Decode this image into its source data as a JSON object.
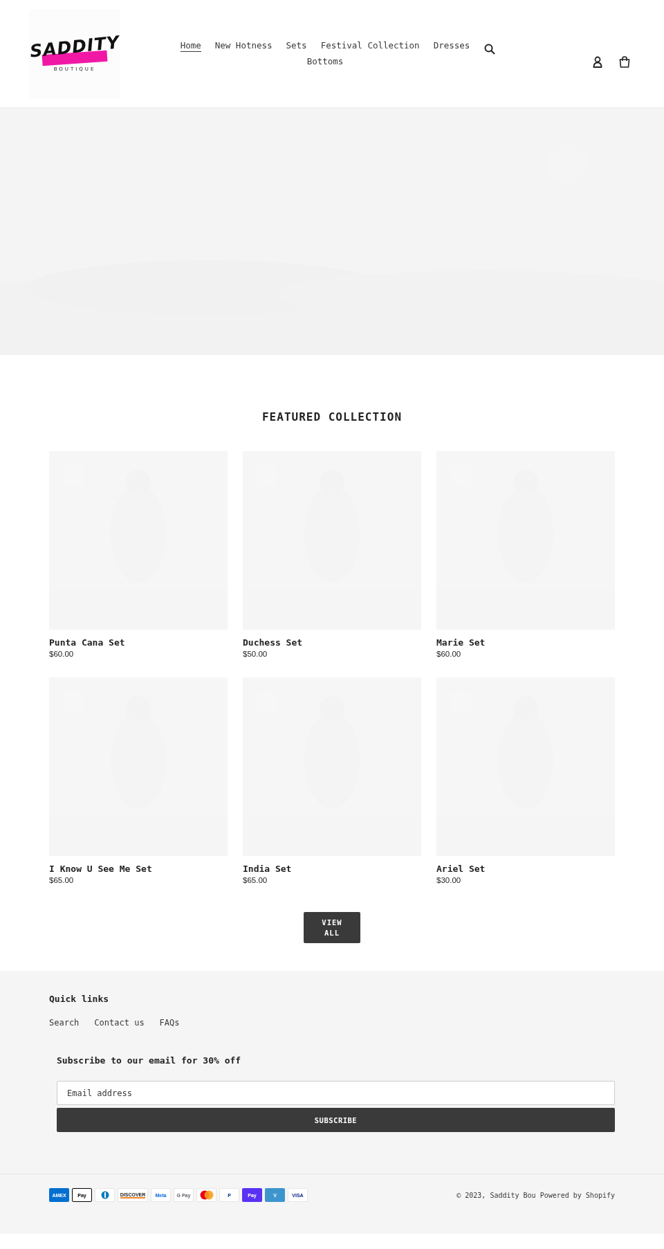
{
  "header": {
    "logo": {
      "title": "SADDITY",
      "subtitle": "BOUTIQUE"
    },
    "nav": [
      {
        "label": "Home",
        "selected": true
      },
      {
        "label": "New Hotness",
        "selected": false
      },
      {
        "label": "Sets",
        "selected": false
      },
      {
        "label": "Festival Collection",
        "selected": false
      },
      {
        "label": "Dresses",
        "selected": false
      },
      {
        "label": "Bottoms",
        "selected": false
      }
    ]
  },
  "featured": {
    "title": "FEATURED COLLECTION",
    "products": [
      {
        "name": "Punta Cana Set",
        "price": "$60.00"
      },
      {
        "name": "Duchess Set",
        "price": "$50.00"
      },
      {
        "name": "Marie Set",
        "price": "$60.00"
      },
      {
        "name": "I Know U See Me Set",
        "price": "$65.00"
      },
      {
        "name": "India Set",
        "price": "$65.00"
      },
      {
        "name": "Ariel Set",
        "price": "$30.00"
      }
    ],
    "button": "VIEW ALL"
  },
  "footer": {
    "quick_links": {
      "title": "Quick links",
      "links": [
        "Search",
        "Contact us",
        "FAQs"
      ]
    },
    "newsletter": {
      "title": "Subscribe to our email for 30% off",
      "placeholder": "Email address",
      "button": "SUBSCRIBE"
    },
    "payments": [
      {
        "kind": "amex",
        "label": "AMEX"
      },
      {
        "kind": "apple",
        "label": "Pay"
      },
      {
        "kind": "diners"
      },
      {
        "kind": "discover",
        "label": "DISCOVER"
      },
      {
        "kind": "meta",
        "label": "Meta"
      },
      {
        "kind": "gpay",
        "label": "G Pay"
      },
      {
        "kind": "mastercard"
      },
      {
        "kind": "paypal",
        "label": "P"
      },
      {
        "kind": "shop",
        "label": "Pay"
      },
      {
        "kind": "venmo",
        "label": "V"
      },
      {
        "kind": "visa",
        "label": "VISA"
      }
    ],
    "copyright": "© 2023, Saddity Bou",
    "powered": "Powered by Shopify"
  }
}
